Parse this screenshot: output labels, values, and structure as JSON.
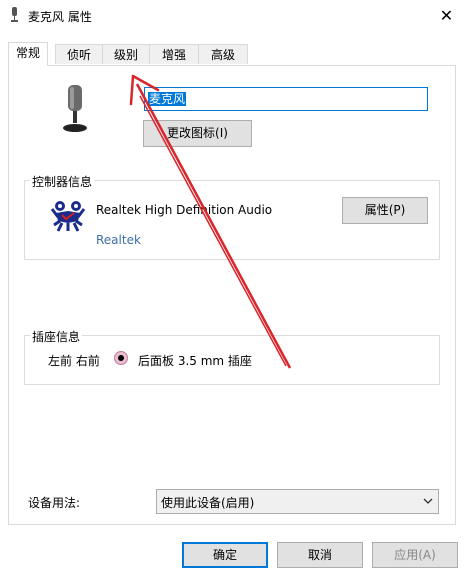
{
  "window": {
    "title": "麦克风 属性",
    "close_glyph": "✕"
  },
  "tabs": [
    {
      "label": "常规",
      "active": true
    },
    {
      "label": "侦听",
      "active": false
    },
    {
      "label": "级别",
      "active": false
    },
    {
      "label": "增强",
      "active": false
    },
    {
      "label": "高级",
      "active": false
    }
  ],
  "general": {
    "device_name_value": "麦克风",
    "change_icon_label": "更改图标(I)"
  },
  "controller": {
    "group_label": "控制器信息",
    "device_name": "Realtek High Definition Audio",
    "vendor": "Realtek",
    "properties_label": "属性(P)"
  },
  "jack": {
    "group_label": "插座信息",
    "position": "左前 右前",
    "description": "后面板 3.5 mm 插座",
    "color": "#e8bfd0"
  },
  "usage": {
    "label": "设备用法:",
    "selected": "使用此设备(启用)"
  },
  "footer": {
    "ok_label": "确定",
    "cancel_label": "取消",
    "apply_label": "应用(A)"
  },
  "colors": {
    "accent": "#0078d7",
    "annotation_arrow": "#d9252b",
    "link": "#3c6ea8"
  }
}
